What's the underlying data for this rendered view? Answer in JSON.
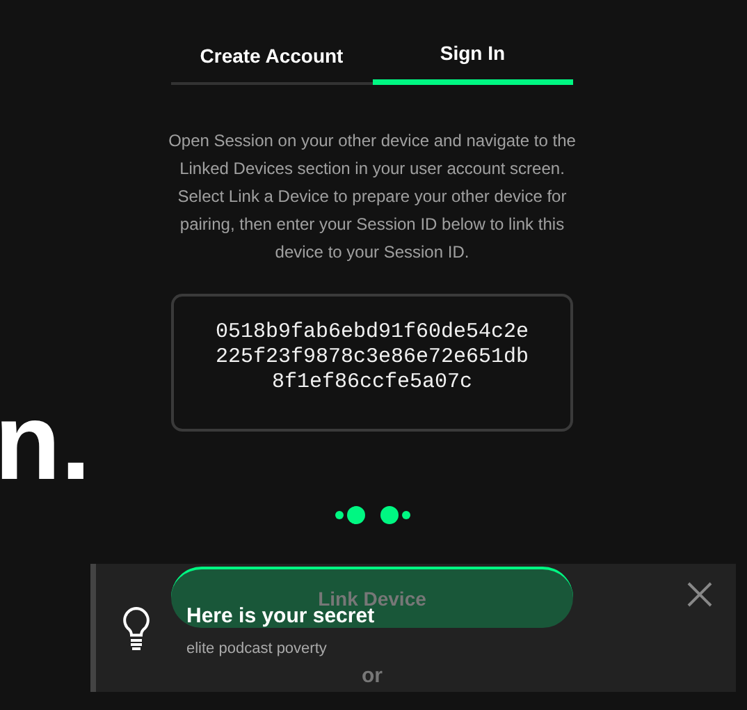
{
  "tabs": [
    {
      "label": "Create Account",
      "selected": false
    },
    {
      "label": "Sign In",
      "selected": true
    }
  ],
  "description": "Open Session on your other device and navigate to the Linked Devices section in your user account screen. Select Link a Device to prepare your other device for pairing, then enter your Session ID below to link this device to your Session ID.",
  "session_id": "0518b9fab6ebd91f60de54c2e225f23f9878c3e86e72e651db8f1ef86ccfe5a07c",
  "background_heading": "n.",
  "link_button": {
    "label": "Link Device",
    "disabled": true
  },
  "divider_text": "or",
  "toast": {
    "title": "Here is your secret",
    "message": "elite podcast poverty"
  }
}
